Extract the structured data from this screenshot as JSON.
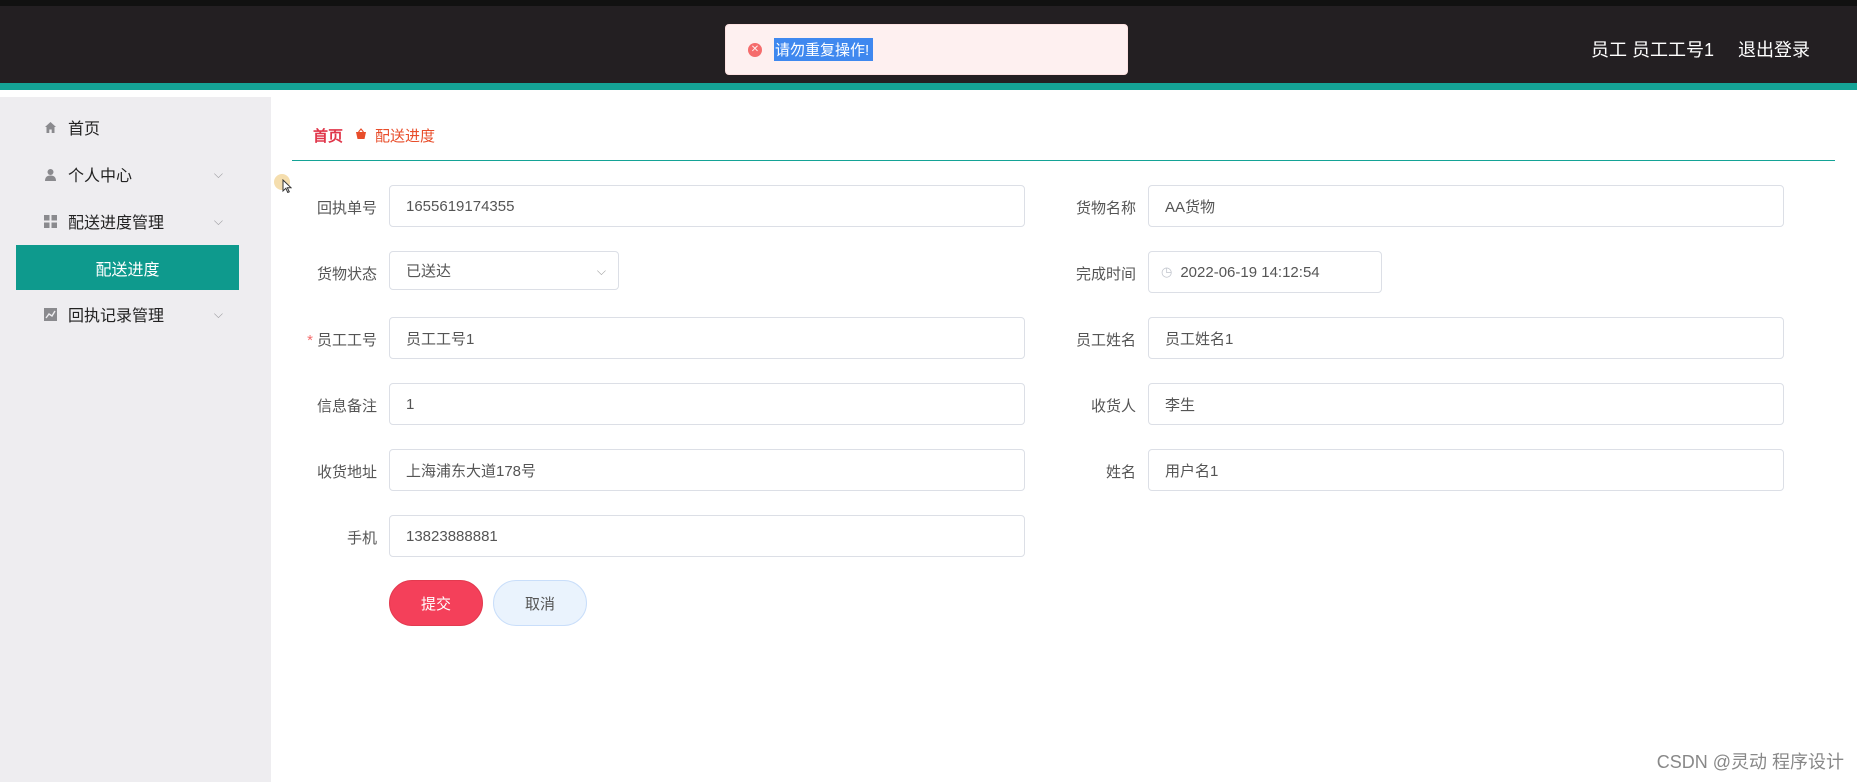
{
  "header": {
    "user_label": "员工 员工工号1",
    "logout_label": "退出登录"
  },
  "toast": {
    "icon": "error-circle-icon",
    "message": "请勿重复操作!"
  },
  "sidebar": {
    "items": [
      {
        "label": "首页",
        "icon": "home-icon"
      },
      {
        "label": "个人中心",
        "icon": "user-icon"
      },
      {
        "label": "配送进度管理",
        "icon": "grid-icon"
      },
      {
        "label": "配送进度",
        "icon": ""
      },
      {
        "label": "回执记录管理",
        "icon": "chart-icon"
      }
    ]
  },
  "breadcrumb": {
    "home": "首页",
    "current": "配送进度"
  },
  "form": {
    "receipt_no": {
      "label": "回执单号",
      "value": "1655619174355"
    },
    "goods_name": {
      "label": "货物名称",
      "value": "AA货物"
    },
    "goods_status": {
      "label": "货物状态",
      "value": "已送达"
    },
    "finish_time": {
      "label": "完成时间",
      "value": "2022-06-19 14:12:54"
    },
    "employee_no": {
      "label": "员工工号",
      "value": "员工工号1",
      "required_mark": "*"
    },
    "employee_name": {
      "label": "员工姓名",
      "value": "员工姓名1"
    },
    "remark": {
      "label": "信息备注",
      "value": "1"
    },
    "receiver": {
      "label": "收货人",
      "value": "李生"
    },
    "address": {
      "label": "收货地址",
      "value": "上海浦东大道178号"
    },
    "name": {
      "label": "姓名",
      "value": "用户名1"
    },
    "phone": {
      "label": "手机",
      "value": "13823888881"
    },
    "submit_label": "提交",
    "cancel_label": "取消"
  },
  "watermark": "CSDN @灵动 程序设计",
  "colors": {
    "header_bg": "#231f22",
    "accent": "#14a396",
    "active_menu": "#0e9a8d",
    "submit": "#f4405a",
    "error": "#f56c6c"
  }
}
